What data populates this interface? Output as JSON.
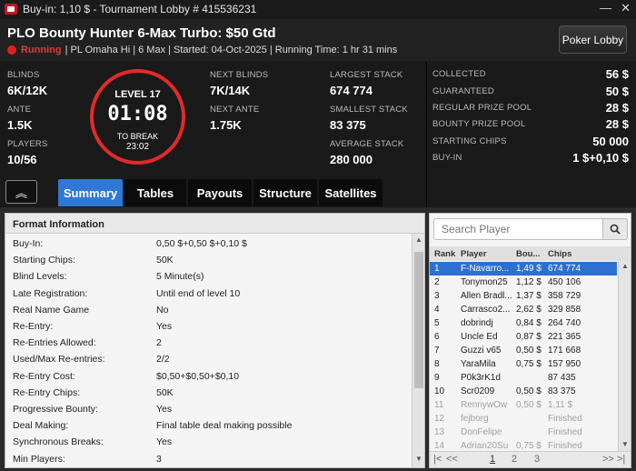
{
  "window": {
    "title": "Buy-in: 1,10 $ - Tournament Lobby # 415536231",
    "minimize": "—",
    "close": "✕"
  },
  "header": {
    "tournament_name": "PLO Bounty Hunter 6-Max Turbo: $50 Gtd",
    "status": "Running",
    "details": "| PL Omaha Hi | 6 Max | Started: 04-Oct-2025 | Running Time: 1 hr  31 mins",
    "lobby_button": "Poker Lobby"
  },
  "stats": {
    "blinds_label": "BLINDS",
    "blinds": "6K/12K",
    "ante_label": "ANTE",
    "ante": "1.5K",
    "players_label": "PLAYERS",
    "players": "10/56",
    "level": "LEVEL 17",
    "clock": "01:08",
    "to_break_label": "TO BREAK",
    "to_break": "23:02",
    "next_blinds_label": "NEXT BLINDS",
    "next_blinds": "7K/14K",
    "next_ante_label": "NEXT ANTE",
    "next_ante": "1.75K",
    "largest_stack_label": "LARGEST STACK",
    "largest_stack": "674 774",
    "smallest_stack_label": "SMALLEST STACK",
    "smallest_stack": "83 375",
    "average_stack_label": "AVERAGE STACK",
    "average_stack": "280 000"
  },
  "prize": [
    {
      "label": "COLLECTED",
      "value": "56 $"
    },
    {
      "label": "GUARANTEED",
      "value": "50 $"
    },
    {
      "label": "REGULAR PRIZE POOL",
      "value": "28 $"
    },
    {
      "label": "BOUNTY PRIZE POOL",
      "value": "28 $"
    },
    {
      "label": "STARTING CHIPS",
      "value": "50 000"
    },
    {
      "label": "BUY-IN",
      "value": "1 $+0,10 $"
    }
  ],
  "tabs": [
    "Summary",
    "Tables",
    "Payouts",
    "Structure",
    "Satellites"
  ],
  "collapse_glyph": "︽",
  "format": {
    "title": "Format Information",
    "rows": [
      {
        "k": "Buy-In:",
        "v": "0,50 $+0,50 $+0,10 $"
      },
      {
        "k": "Starting Chips:",
        "v": "50K"
      },
      {
        "k": "Blind Levels:",
        "v": "5 Minute(s)"
      },
      {
        "k": "Late Registration:",
        "v": "Until end of level 10"
      },
      {
        "k": "Real Name Game",
        "v": "No"
      },
      {
        "k": "Re-Entry:",
        "v": "Yes"
      },
      {
        "k": "Re-Entries Allowed:",
        "v": "2"
      },
      {
        "k": "Used/Max Re-entries:",
        "v": "2/2"
      },
      {
        "k": "Re-Entry Cost:",
        "v": "$0,50+$0,50+$0,10"
      },
      {
        "k": "Re-Entry Chips:",
        "v": "50K"
      },
      {
        "k": "Progressive Bounty:",
        "v": "Yes"
      },
      {
        "k": "Deal Making:",
        "v": "Final table deal making possible"
      },
      {
        "k": "Synchronous Breaks:",
        "v": "Yes"
      },
      {
        "k": "Min Players:",
        "v": "3"
      }
    ]
  },
  "players_panel": {
    "search_placeholder": "Search Player",
    "headers": {
      "rank": "Rank",
      "player": "Player",
      "bounty": "Bou...",
      "chips": "Chips"
    },
    "rows": [
      {
        "rank": "1",
        "player": "F-Navarro...",
        "bounty": "1,49 $",
        "chips": "674 774",
        "state": "sel"
      },
      {
        "rank": "2",
        "player": "Tonymon25",
        "bounty": "1,12 $",
        "chips": "450 106",
        "state": ""
      },
      {
        "rank": "3",
        "player": "Allen Bradl...",
        "bounty": "1,37 $",
        "chips": "358 729",
        "state": ""
      },
      {
        "rank": "4",
        "player": "Carrasco2...",
        "bounty": "2,62 $",
        "chips": "329 858",
        "state": ""
      },
      {
        "rank": "5",
        "player": "dobrindj",
        "bounty": "0,84 $",
        "chips": "264 740",
        "state": ""
      },
      {
        "rank": "6",
        "player": "Uncle Ed",
        "bounty": "0,87 $",
        "chips": "221 365",
        "state": ""
      },
      {
        "rank": "7",
        "player": "Guzzi v65",
        "bounty": "0,50 $",
        "chips": "171 668",
        "state": ""
      },
      {
        "rank": "8",
        "player": "YaraMila",
        "bounty": "0,75 $",
        "chips": "157 950",
        "state": ""
      },
      {
        "rank": "9",
        "player": "P0k3rK1d",
        "bounty": "",
        "chips": "87 435",
        "state": ""
      },
      {
        "rank": "10",
        "player": "Scr0209",
        "bounty": "0,50 $",
        "chips": "83 375",
        "state": ""
      },
      {
        "rank": "11",
        "player": "RennywOw",
        "bounty": "0,50 $",
        "chips": "1,11 $",
        "state": "out"
      },
      {
        "rank": "12",
        "player": "fejborg",
        "bounty": "",
        "chips": "Finished",
        "state": "out"
      },
      {
        "rank": "13",
        "player": "DonFelipe",
        "bounty": "",
        "chips": "Finished",
        "state": "out"
      },
      {
        "rank": "14",
        "player": "Adrian20Su",
        "bounty": "0,75 $",
        "chips": "Finished",
        "state": "out"
      }
    ],
    "pager": {
      "first": "|<",
      "prev": "<<",
      "pages": [
        "1",
        "2",
        "3"
      ],
      "next": ">>",
      "last": ">|"
    }
  }
}
